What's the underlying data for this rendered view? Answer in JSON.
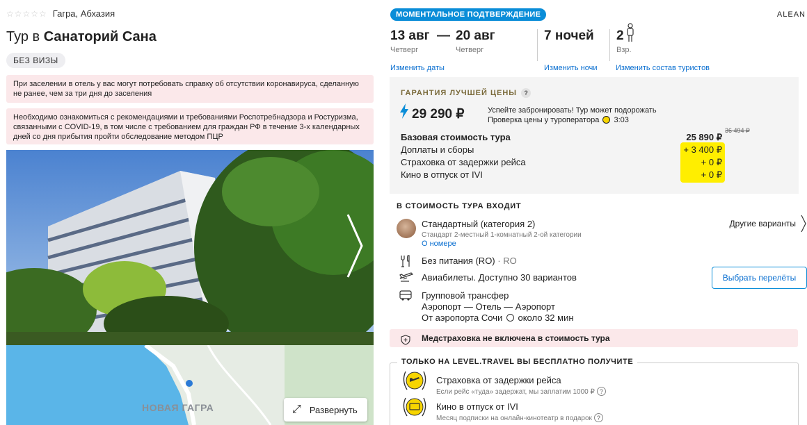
{
  "location": {
    "stars": "☆☆☆☆☆",
    "city": "Гагра, Абхазия"
  },
  "title": {
    "prefix": "Тур в ",
    "hotel": "Санаторий Сана"
  },
  "visa_badge": "Без визы",
  "notices": [
    "При заселении в отель у вас могут потребовать справку об отсутствии коронавируса, сделанную не ранее, чем за три дня до заселения",
    "Необходимо ознакомиться с рекомендациями и требованиями Роспотребнадзора и Ростуризма, связанными с COVID-19, в том числе с требованием для граждан РФ в течение 3-х календарных дней со дня прибытия пройти обследование методом ПЦР"
  ],
  "map": {
    "label": "НОВАЯ ГАГРА",
    "expand_label": "Развернуть"
  },
  "instant_badge": "МОМЕНТАЛЬНОЕ ПОДТВЕРЖДЕНИЕ",
  "operator": "ALEAN",
  "dates": {
    "from": {
      "date": "13 авг",
      "weekday": "Четверг"
    },
    "dash": "—",
    "to": {
      "date": "20 авг",
      "weekday": "Четверг"
    },
    "nights": "7 ночей",
    "adults": "2",
    "adults_label": "Взр."
  },
  "links": {
    "change_dates": "Изменить даты",
    "change_nights": "Изменить ночи",
    "change_tourists": "Изменить состав туристов"
  },
  "price": {
    "guarantee": "ГАРАНТИЯ ЛУЧШЕЙ ЦЕНЫ",
    "qmark": "?",
    "total": "29 290 ₽",
    "hurry_line1": "Успейте забронировать! Тур может подорожать",
    "hurry_line2": "Проверка цены у туроператора",
    "timer": "3:03",
    "old_price": "36 494 ₽",
    "rows": [
      {
        "label": "Базовая стоимость тура",
        "value": "25 890 ₽"
      },
      {
        "label": "Доплаты и сборы",
        "value": "+ 3 400 ₽"
      },
      {
        "label": "Страховка от задержки рейса",
        "value": "+ 0 ₽"
      },
      {
        "label": "Кино в отпуск от IVI",
        "value": "+ 0 ₽"
      }
    ]
  },
  "included": {
    "title": "В СТОИМОСТЬ ТУРА ВХОДИТ",
    "room": "Стандартный (категория 2)",
    "room_sub": "Стандарт 2-местный 1-комнатный 2-ой категории",
    "room_link": "О номере",
    "other_variants": "Другие варианты",
    "meal": "Без питания (RO)",
    "meal_code": "· RO",
    "flights": "Авиабилеты. Доступно 30 вариантов",
    "choose_flights": "Выбрать перелёты",
    "transfer": "Групповой трансфер",
    "transfer_route": "Аэропорт — Отель — Аэропорт",
    "transfer_from": "От аэропорта Сочи",
    "transfer_time": "около 32 мин"
  },
  "med_notice": "Медстраховка не включена в стоимость тура",
  "free": {
    "title": "ТОЛЬКО НА LEVEL.TRAVEL ВЫ БЕСПЛАТНО ПОЛУЧИТЕ",
    "items": [
      {
        "label": "Страховка от задержки рейса",
        "sub": "Если рейс «туда» задержат, мы заплатим 1000 ₽"
      },
      {
        "label": "Кино в отпуск от IVI",
        "sub": "Месяц подписки на онлайн-кинотеатр в подарок"
      }
    ],
    "qm": "?"
  },
  "colors": {
    "accent_blue": "#0a8dd8",
    "link_blue": "#0a6fd0",
    "notice_pink": "#fbe8ea",
    "highlight_yellow": "#ffee00",
    "guarantee_gold": "#7a6a3a"
  }
}
